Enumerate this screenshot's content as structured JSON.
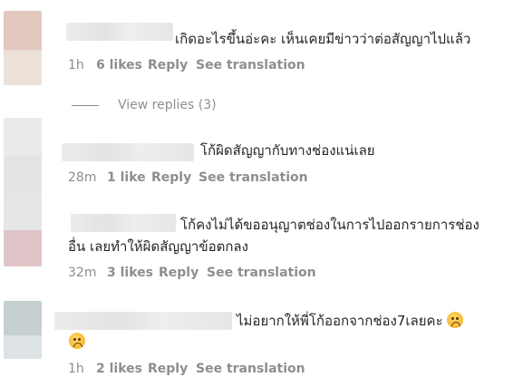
{
  "comments": [
    {
      "text": "เกิดอะไรขึ้นอ่ะคะ เห็นเคยมีข่าวว่าต่อสัญญาไปแล้ว",
      "time": "1h",
      "likes": "6 likes",
      "reply": "Reply",
      "translate": "See translation"
    },
    {
      "text": "โก้ผิดสัญญากับทางช่องแน่เลย",
      "time": "28m",
      "likes": "1 like",
      "reply": "Reply",
      "translate": "See translation"
    },
    {
      "text_line1": "โก้คงไม่ได้ขออนุญาตช่องในการไปออกรายการช่อง",
      "text_line2": "อื่น เลยทำให้ผิดสัญญาข้อตกลง",
      "time": "32m",
      "likes": "3 likes",
      "reply": "Reply",
      "translate": "See translation"
    },
    {
      "text": "ไม่อยากให้พี่โก้ออกจากช่อง7เลยคะ",
      "time": "1h",
      "likes": "2 likes",
      "reply": "Reply",
      "translate": "See translation"
    }
  ],
  "view_replies": "View replies (3)",
  "icons": {
    "emoji": "sad-face-emoji"
  },
  "colors": {
    "text": "#262626",
    "meta": "#8e8e8e"
  }
}
